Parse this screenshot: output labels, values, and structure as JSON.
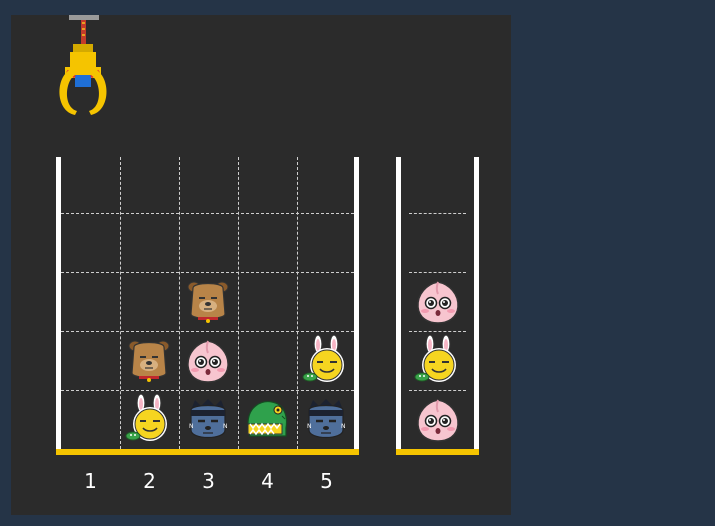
{
  "colors": {
    "page_bg": "#253447",
    "board_bg": "#2b2b2b",
    "wall": "#ffffff",
    "floor": "#f5c400",
    "grid_dash": "#cfcfcf"
  },
  "column_labels": [
    "1",
    "2",
    "3",
    "4",
    "5"
  ],
  "board": {
    "rows": 5,
    "columns": 5,
    "cells": [
      {
        "col": 2,
        "row": 1,
        "doll": "muzi"
      },
      {
        "col": 2,
        "row": 2,
        "doll": "frodo"
      },
      {
        "col": 3,
        "row": 1,
        "doll": "neo"
      },
      {
        "col": 3,
        "row": 2,
        "doll": "apeach"
      },
      {
        "col": 3,
        "row": 3,
        "doll": "frodo"
      },
      {
        "col": 4,
        "row": 1,
        "doll": "con"
      },
      {
        "col": 5,
        "row": 1,
        "doll": "neo"
      },
      {
        "col": 5,
        "row": 2,
        "doll": "muzi"
      }
    ]
  },
  "basket": {
    "slots": 4,
    "stack": [
      "apeach",
      "muzi",
      "apeach"
    ]
  },
  "crane": {
    "icon": "crane-claw-icon",
    "column": 1
  }
}
